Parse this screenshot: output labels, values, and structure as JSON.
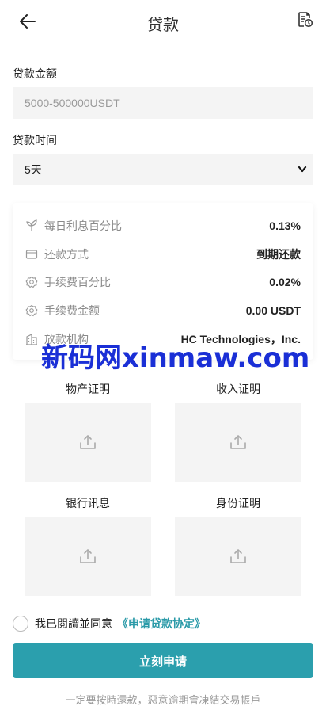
{
  "header": {
    "title": "贷款",
    "back_icon": "arrow-left-icon",
    "record_icon": "document-history-icon"
  },
  "amount": {
    "label": "贷款金额",
    "placeholder": "5000-500000USDT"
  },
  "term": {
    "label": "贷款时间",
    "selected": "5天"
  },
  "details": [
    {
      "icon": "sprout-icon",
      "label": "每日利息百分比",
      "value": "0.13%"
    },
    {
      "icon": "wallet-icon",
      "label": "还款方式",
      "value": "到期还款"
    },
    {
      "icon": "gear-icon",
      "label": "手续费百分比",
      "value": "0.02%"
    },
    {
      "icon": "gear-icon",
      "label": "手续费金额",
      "value": "0.00 USDT"
    },
    {
      "icon": "building-icon",
      "label": "放款机构",
      "value": "HC Technologies，Inc."
    }
  ],
  "watermark": "新码网xinmaw.com",
  "uploads": [
    {
      "label": "物产证明"
    },
    {
      "label": "收入证明"
    },
    {
      "label": "银行讯息"
    },
    {
      "label": "身份证明"
    }
  ],
  "agreement": {
    "text": "我已閱讀並同意",
    "link": "《申请贷款协定》"
  },
  "submit_label": "立刻申请",
  "notice": "一定要按時還款，惡意逾期會凍結交易帳戶",
  "colors": {
    "accent": "#2b9fad",
    "link": "#2a9aa8",
    "field_bg": "#f4f4f4",
    "watermark": "#1a2fd6"
  }
}
